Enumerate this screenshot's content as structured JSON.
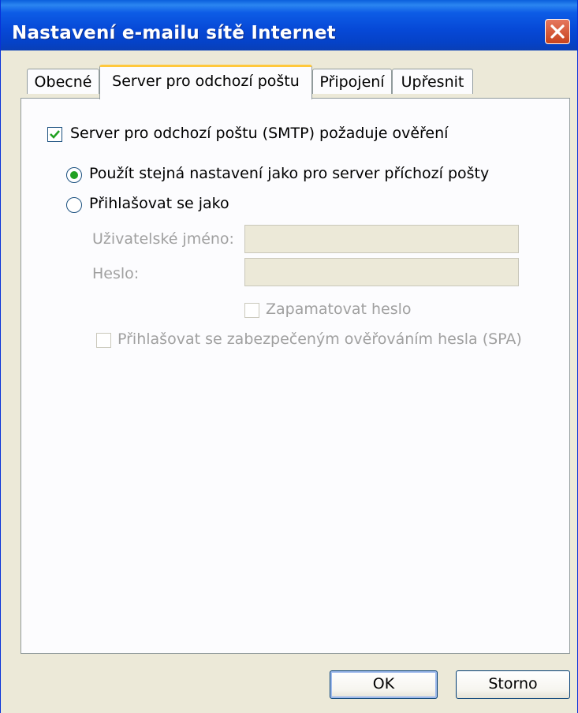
{
  "window": {
    "title": "Nastavení e-mailu sítě Internet"
  },
  "tabs": [
    {
      "label": "Obecné"
    },
    {
      "label": "Server pro odchozí poštu"
    },
    {
      "label": "Připojení"
    },
    {
      "label": "Upřesnit"
    }
  ],
  "smtp_auth": {
    "label": "Server pro odchozí poštu (SMTP) požaduje ověření",
    "checked": true
  },
  "options": {
    "same_settings": {
      "label": "Použít stejná nastavení jako pro server příchozí pošty",
      "selected": true
    },
    "login_as": {
      "label": "Přihlašovat se jako",
      "selected": false
    }
  },
  "fields": {
    "username": {
      "label": "Uživatelské jméno:",
      "value": ""
    },
    "password": {
      "label": "Heslo:",
      "value": ""
    }
  },
  "remember_password": {
    "label": "Zapamatovat heslo",
    "checked": false,
    "enabled": false
  },
  "spa": {
    "label": "Přihlašovat se zabezpečeným ověřováním hesla (SPA)",
    "checked": false,
    "enabled": false
  },
  "buttons": {
    "ok": "OK",
    "cancel": "Storno"
  },
  "colors": {
    "titlebar": "#0648d6",
    "accent_tab": "#ffc83c",
    "radio_dot": "#21a121",
    "check": "#21a121"
  }
}
